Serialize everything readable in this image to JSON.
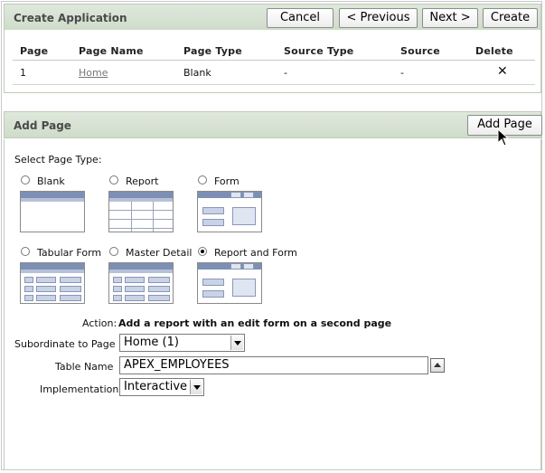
{
  "create_region": {
    "title": "Create Application",
    "buttons": {
      "cancel": "Cancel",
      "previous": "< Previous",
      "next": "Next >",
      "create": "Create"
    }
  },
  "pages_table": {
    "columns": [
      "Page",
      "Page Name",
      "Page Type",
      "Source Type",
      "Source",
      "Delete"
    ],
    "rows": [
      {
        "page": "1",
        "page_name": "Home",
        "page_type": "Blank",
        "source_type": "-",
        "source": "-",
        "delete": "✕"
      }
    ]
  },
  "add_region": {
    "title": "Add Page",
    "add_button": "Add Page",
    "select_page_type_label": "Select Page Type:",
    "page_types": [
      {
        "label": "Blank",
        "selected": false,
        "icon": "blank-page-icon"
      },
      {
        "label": "Report",
        "selected": false,
        "icon": "report-page-icon"
      },
      {
        "label": "Form",
        "selected": false,
        "icon": "form-page-icon"
      },
      {
        "label": "Tabular Form",
        "selected": false,
        "icon": "tabular-form-page-icon"
      },
      {
        "label": "Master Detail",
        "selected": false,
        "icon": "master-detail-page-icon"
      },
      {
        "label": "Report and Form",
        "selected": true,
        "icon": "report-and-form-page-icon"
      }
    ],
    "action_label": "Action:",
    "action_text": "Add a report with an edit form on a second page",
    "subordinate_label": "Subordinate to Page",
    "subordinate_value": "Home (1)",
    "table_name_label": "Table Name",
    "table_name_value": "APEX_EMPLOYEES",
    "implementation_label": "Implementation",
    "implementation_value": "Interactive"
  },
  "colors": {
    "region_header": "#d6e1d2",
    "thumb_header": "#7d8fb4",
    "thumb_cell": "#c9d2e6"
  }
}
